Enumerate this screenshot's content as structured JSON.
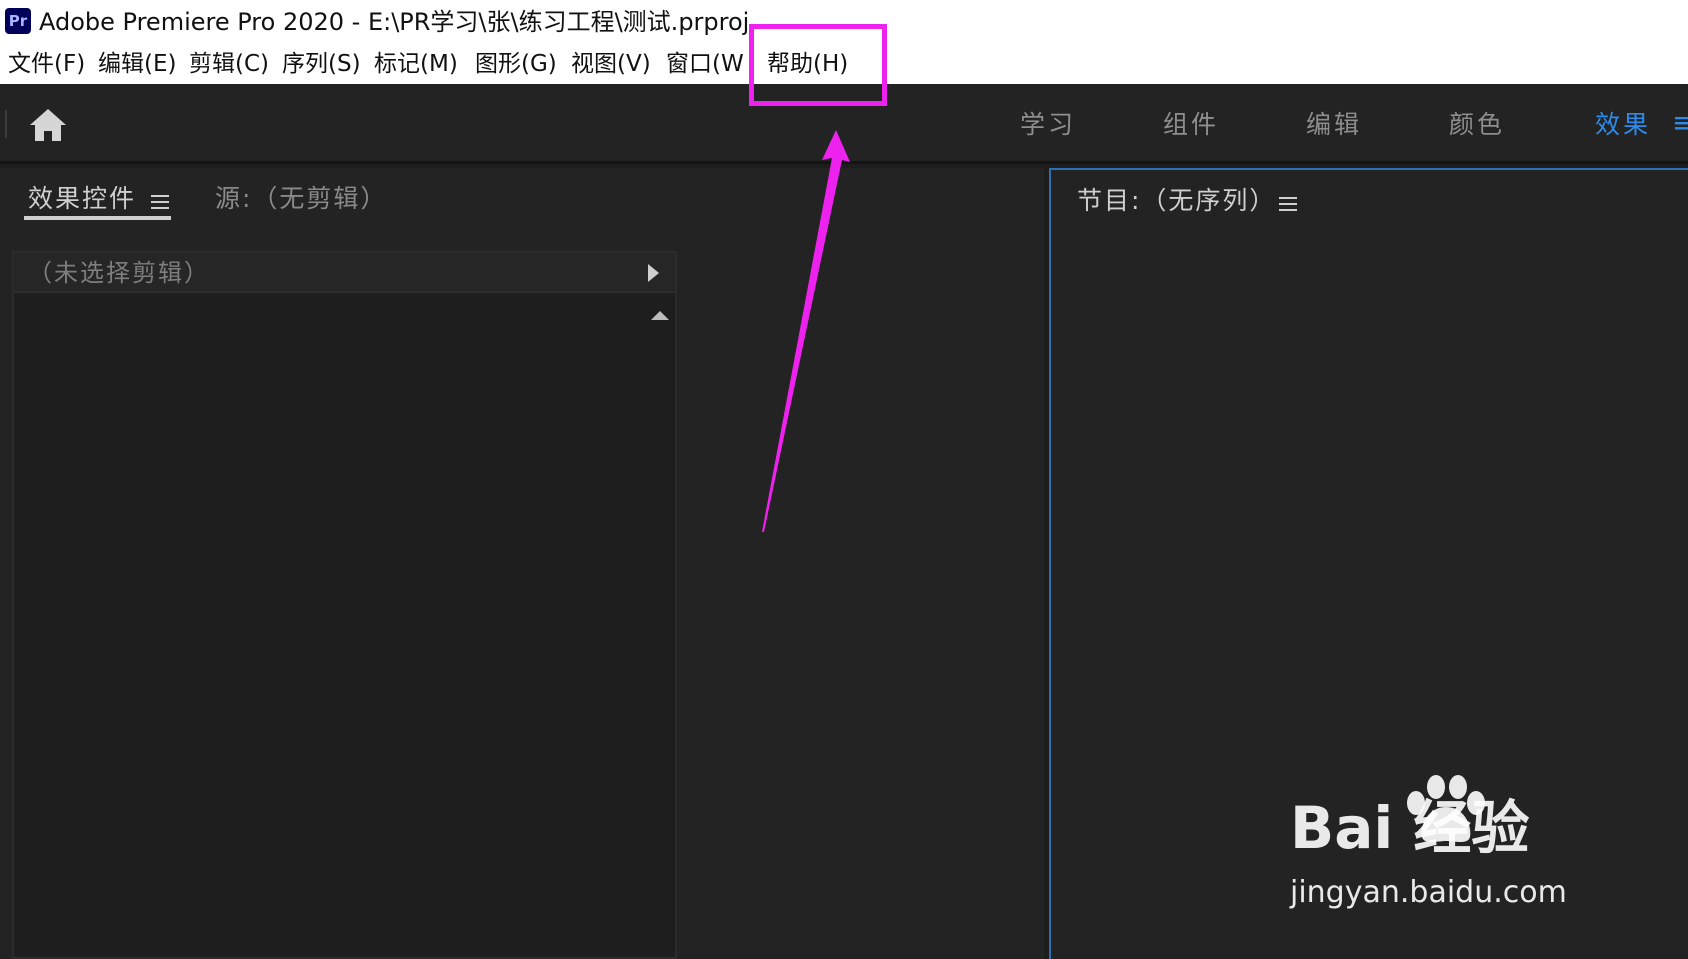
{
  "window": {
    "app_icon_label": "Pr",
    "title": "Adobe Premiere Pro 2020 - E:\\PR学习\\张\\练习工程\\测试.prproj"
  },
  "menu": {
    "items": [
      {
        "label": "文件(F)"
      },
      {
        "label": "编辑(E)"
      },
      {
        "label": "剪辑(C)"
      },
      {
        "label": "序列(S)"
      },
      {
        "label": "标记(M)"
      },
      {
        "label": "图形(G)"
      },
      {
        "label": "视图(V)"
      },
      {
        "label": "窗口(W"
      },
      {
        "label": "帮助(H)"
      }
    ]
  },
  "workspace": {
    "tabs": [
      {
        "label": "学习"
      },
      {
        "label": "组件"
      },
      {
        "label": "编辑"
      },
      {
        "label": "颜色"
      },
      {
        "label": "效果",
        "active": true
      }
    ],
    "more_glyph": "≡"
  },
  "left_panel": {
    "tab_effect_controls": "效果控件",
    "tab_source": "源:（无剪辑）",
    "no_clip_selected": "（未选择剪辑）"
  },
  "right_panel": {
    "tab_program": "节目:（无序列）"
  },
  "watermark": {
    "brand": "Bai  经验",
    "url": "jingyan.baidu.com"
  },
  "colors": {
    "highlight": "#ee22ee",
    "accent": "#2d8ceb",
    "panel_bg": "#232323"
  }
}
